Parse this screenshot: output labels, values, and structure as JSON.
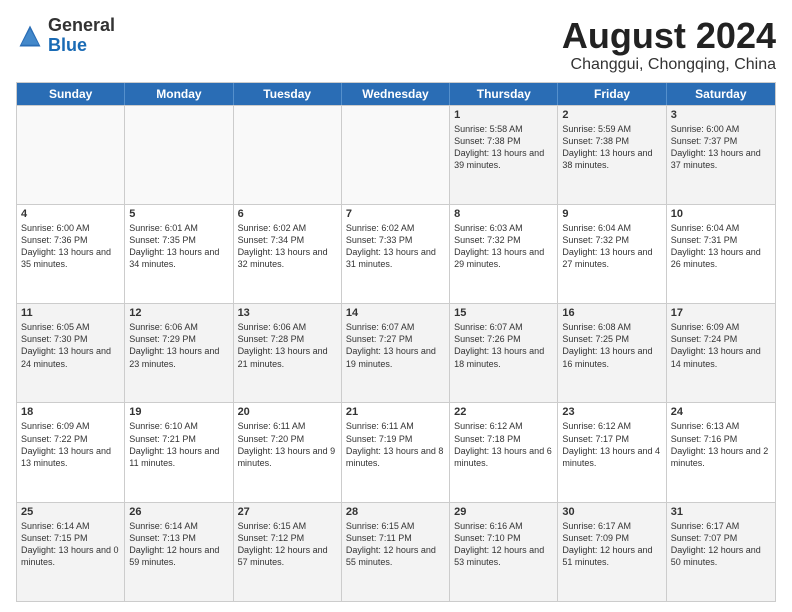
{
  "header": {
    "logo_general": "General",
    "logo_blue": "Blue",
    "month_year": "August 2024",
    "location": "Changgui, Chongqing, China"
  },
  "weekdays": [
    "Sunday",
    "Monday",
    "Tuesday",
    "Wednesday",
    "Thursday",
    "Friday",
    "Saturday"
  ],
  "weeks": [
    [
      {
        "day": "",
        "empty": true
      },
      {
        "day": "",
        "empty": true
      },
      {
        "day": "",
        "empty": true
      },
      {
        "day": "",
        "empty": true
      },
      {
        "day": "1",
        "sunrise": "5:58 AM",
        "sunset": "7:38 PM",
        "daylight": "13 hours and 39 minutes."
      },
      {
        "day": "2",
        "sunrise": "5:59 AM",
        "sunset": "7:38 PM",
        "daylight": "13 hours and 38 minutes."
      },
      {
        "day": "3",
        "sunrise": "6:00 AM",
        "sunset": "7:37 PM",
        "daylight": "13 hours and 37 minutes."
      }
    ],
    [
      {
        "day": "4",
        "sunrise": "6:00 AM",
        "sunset": "7:36 PM",
        "daylight": "13 hours and 35 minutes."
      },
      {
        "day": "5",
        "sunrise": "6:01 AM",
        "sunset": "7:35 PM",
        "daylight": "13 hours and 34 minutes."
      },
      {
        "day": "6",
        "sunrise": "6:02 AM",
        "sunset": "7:34 PM",
        "daylight": "13 hours and 32 minutes."
      },
      {
        "day": "7",
        "sunrise": "6:02 AM",
        "sunset": "7:33 PM",
        "daylight": "13 hours and 31 minutes."
      },
      {
        "day": "8",
        "sunrise": "6:03 AM",
        "sunset": "7:32 PM",
        "daylight": "13 hours and 29 minutes."
      },
      {
        "day": "9",
        "sunrise": "6:04 AM",
        "sunset": "7:32 PM",
        "daylight": "13 hours and 27 minutes."
      },
      {
        "day": "10",
        "sunrise": "6:04 AM",
        "sunset": "7:31 PM",
        "daylight": "13 hours and 26 minutes."
      }
    ],
    [
      {
        "day": "11",
        "sunrise": "6:05 AM",
        "sunset": "7:30 PM",
        "daylight": "13 hours and 24 minutes."
      },
      {
        "day": "12",
        "sunrise": "6:06 AM",
        "sunset": "7:29 PM",
        "daylight": "13 hours and 23 minutes."
      },
      {
        "day": "13",
        "sunrise": "6:06 AM",
        "sunset": "7:28 PM",
        "daylight": "13 hours and 21 minutes."
      },
      {
        "day": "14",
        "sunrise": "6:07 AM",
        "sunset": "7:27 PM",
        "daylight": "13 hours and 19 minutes."
      },
      {
        "day": "15",
        "sunrise": "6:07 AM",
        "sunset": "7:26 PM",
        "daylight": "13 hours and 18 minutes."
      },
      {
        "day": "16",
        "sunrise": "6:08 AM",
        "sunset": "7:25 PM",
        "daylight": "13 hours and 16 minutes."
      },
      {
        "day": "17",
        "sunrise": "6:09 AM",
        "sunset": "7:24 PM",
        "daylight": "13 hours and 14 minutes."
      }
    ],
    [
      {
        "day": "18",
        "sunrise": "6:09 AM",
        "sunset": "7:22 PM",
        "daylight": "13 hours and 13 minutes."
      },
      {
        "day": "19",
        "sunrise": "6:10 AM",
        "sunset": "7:21 PM",
        "daylight": "13 hours and 11 minutes."
      },
      {
        "day": "20",
        "sunrise": "6:11 AM",
        "sunset": "7:20 PM",
        "daylight": "13 hours and 9 minutes."
      },
      {
        "day": "21",
        "sunrise": "6:11 AM",
        "sunset": "7:19 PM",
        "daylight": "13 hours and 8 minutes."
      },
      {
        "day": "22",
        "sunrise": "6:12 AM",
        "sunset": "7:18 PM",
        "daylight": "13 hours and 6 minutes."
      },
      {
        "day": "23",
        "sunrise": "6:12 AM",
        "sunset": "7:17 PM",
        "daylight": "13 hours and 4 minutes."
      },
      {
        "day": "24",
        "sunrise": "6:13 AM",
        "sunset": "7:16 PM",
        "daylight": "13 hours and 2 minutes."
      }
    ],
    [
      {
        "day": "25",
        "sunrise": "6:14 AM",
        "sunset": "7:15 PM",
        "daylight": "13 hours and 0 minutes."
      },
      {
        "day": "26",
        "sunrise": "6:14 AM",
        "sunset": "7:13 PM",
        "daylight": "12 hours and 59 minutes."
      },
      {
        "day": "27",
        "sunrise": "6:15 AM",
        "sunset": "7:12 PM",
        "daylight": "12 hours and 57 minutes."
      },
      {
        "day": "28",
        "sunrise": "6:15 AM",
        "sunset": "7:11 PM",
        "daylight": "12 hours and 55 minutes."
      },
      {
        "day": "29",
        "sunrise": "6:16 AM",
        "sunset": "7:10 PM",
        "daylight": "12 hours and 53 minutes."
      },
      {
        "day": "30",
        "sunrise": "6:17 AM",
        "sunset": "7:09 PM",
        "daylight": "12 hours and 51 minutes."
      },
      {
        "day": "31",
        "sunrise": "6:17 AM",
        "sunset": "7:07 PM",
        "daylight": "12 hours and 50 minutes."
      }
    ]
  ]
}
